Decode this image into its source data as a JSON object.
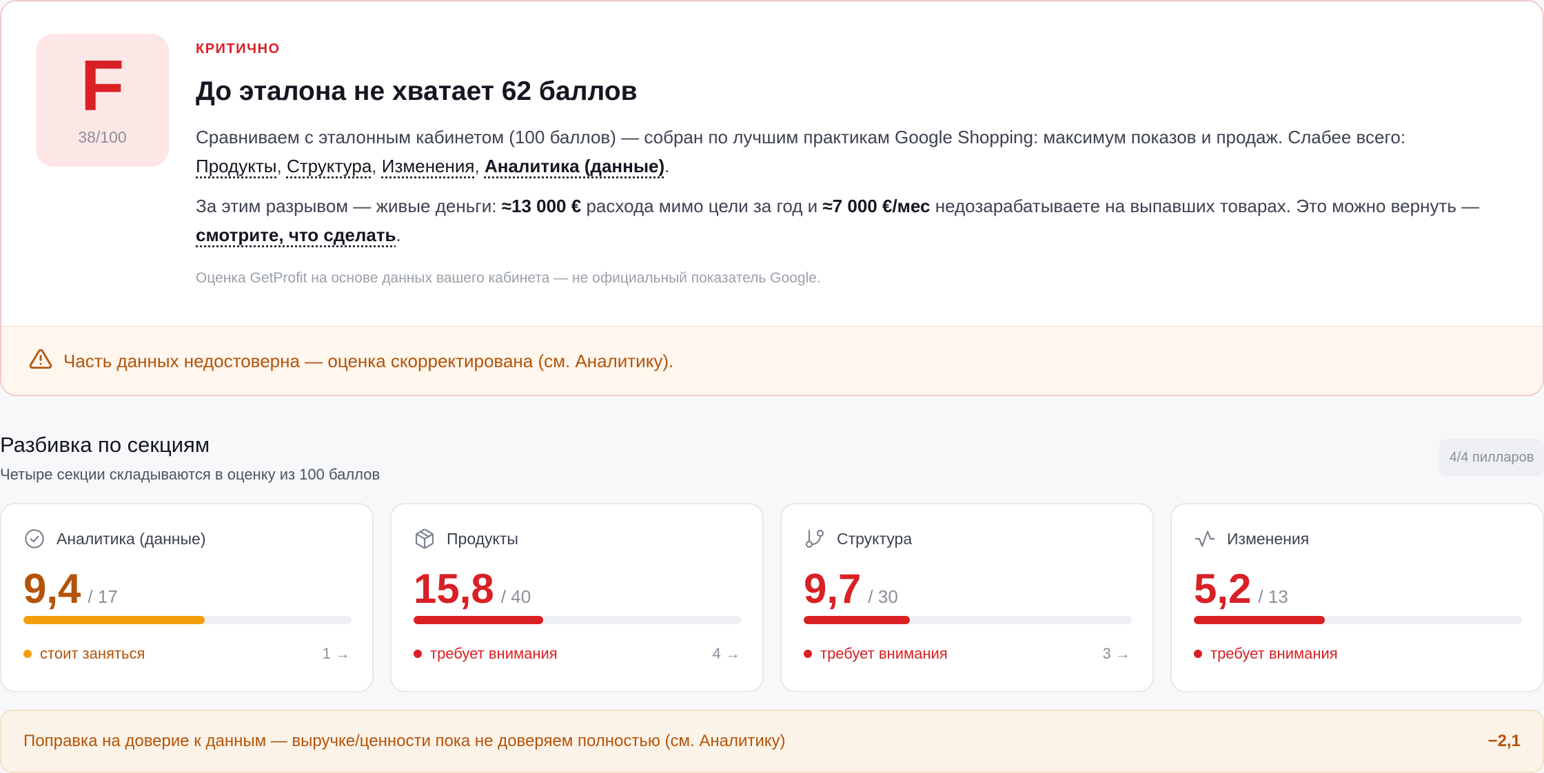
{
  "colors": {
    "critical": "#d92025",
    "warning": "#b45309",
    "amber": "#f59e0b",
    "grade_bg": "#fde6e6",
    "warning_bg": "#fff6ee"
  },
  "summary": {
    "grade": "F",
    "score_text": "38/100",
    "severity": "КРИТИЧНО",
    "headline": "До эталона не хватает 62 баллов",
    "para1_text": "Сравниваем с эталонным кабинетом (100 баллов) — собран по лучшим практикам Google Shopping: максимум показов и продаж. Слабее всего:",
    "weak_links": [
      "Продукты",
      "Структура",
      "Изменения",
      "Аналитика (данные)"
    ],
    "para2_prefix": "За этим разрывом — живые деньги:",
    "money_spend": "≈13 000 €",
    "para2_mid": "расхода мимо цели за год и",
    "money_lost": "≈7 000 €/мес",
    "para2_suffix": "недозарабатываете на выпавших товарах. Это можно вернуть —",
    "action_link": "смотрите, что сделать",
    "disclaimer": "Оценка GetProfit на основе данных вашего кабинета — не официальный показатель Google."
  },
  "data_warning": {
    "icon": "warning-triangle-icon",
    "text": "Часть данных недостоверна — оценка скорректирована (см. Аналитику)."
  },
  "breakdown": {
    "title": "Разбивка по секциям",
    "subtitle": "Четыре секции складываются в оценку из 100 баллов",
    "pillars_badge": "4/4 пилларов",
    "cards": [
      {
        "icon": "check-circle-icon",
        "title": "Аналитика (данные)",
        "value": "9,4",
        "max": "/ 17",
        "fill": 0.553,
        "color": "#b45309",
        "bar_color": "#f59e0b",
        "status": "стоит заняться",
        "status_color": "#b45309",
        "dot_color": "#f59e0b",
        "count": "1 →"
      },
      {
        "icon": "box-icon",
        "title": "Продукты",
        "value": "15,8",
        "max": "/ 40",
        "fill": 0.395,
        "color": "#d92025",
        "bar_color": "#d92025",
        "status": "требует внимания",
        "status_color": "#d92025",
        "dot_color": "#d92025",
        "count": "4 →"
      },
      {
        "icon": "git-branch-icon",
        "title": "Структура",
        "value": "9,7",
        "max": "/ 30",
        "fill": 0.323,
        "color": "#d92025",
        "bar_color": "#d92025",
        "status": "требует внимания",
        "status_color": "#d92025",
        "dot_color": "#d92025",
        "count": "3 →"
      },
      {
        "icon": "activity-icon",
        "title": "Изменения",
        "value": "5,2",
        "max": "/ 13",
        "fill": 0.4,
        "color": "#d92025",
        "bar_color": "#d92025",
        "status": "требует внимания",
        "status_color": "#d92025",
        "dot_color": "#d92025",
        "count": ""
      }
    ]
  },
  "adjustment": {
    "text": "Поправка на доверие к данным — выручке/ценности пока не доверяем полностью (см. Аналитику)",
    "value": "−2,1"
  }
}
